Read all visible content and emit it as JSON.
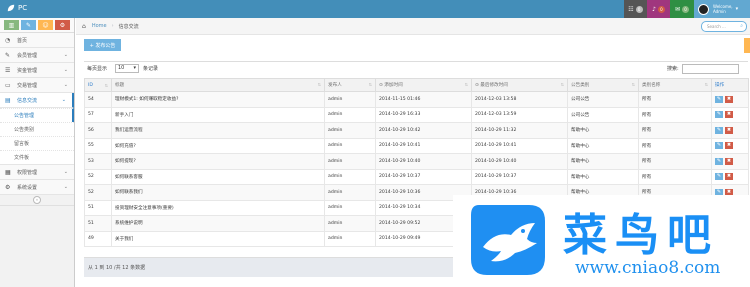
{
  "navbar": {
    "brand": "PC",
    "colors": {
      "bar": "#438eb9",
      "tasks": "#555555",
      "notifications": "#a0367e",
      "messages": "#2f8f43",
      "user": "#62a8d1"
    },
    "buttons": [
      {
        "icon": "tasks-icon",
        "badge": "0"
      },
      {
        "icon": "bell-icon",
        "badge": "0"
      },
      {
        "icon": "envelope-icon",
        "badge": "0"
      }
    ],
    "user": {
      "greeting": "Welcome,",
      "name": "Admin",
      "caret": "▾"
    }
  },
  "sidebar": {
    "shortcut_colors": [
      "#87b87f",
      "#6fb3e0",
      "#ffb752",
      "#d15b47"
    ],
    "shortcut_icons": [
      "chart-icon",
      "pencil-icon",
      "users-icon",
      "cogs-icon"
    ],
    "items": [
      {
        "label": "首页",
        "icon": "dashboard-icon"
      },
      {
        "label": "会员管理",
        "icon": "edit-icon"
      },
      {
        "label": "资金管理",
        "icon": "list-icon"
      },
      {
        "label": "交易管理",
        "icon": "desktop-icon"
      },
      {
        "label": "信息交流",
        "icon": "list-alt-icon",
        "active": true
      },
      {
        "label": "权限管理",
        "icon": "calendar-icon"
      },
      {
        "label": "系统设置",
        "icon": "gear-icon"
      }
    ],
    "submenu": [
      "公告管理",
      "公告类别",
      "留言板",
      "文件板"
    ],
    "collapse_glyph": "«"
  },
  "breadcrumbs": {
    "home": "Home",
    "current": "信息交流"
  },
  "search": {
    "placeholder": "Search ..."
  },
  "content": {
    "add_button": "+ 发布公告",
    "length_label": "每页显示",
    "length_value": "10",
    "length_suffix": "条记录",
    "filter_label": "搜索:"
  },
  "table": {
    "columns": [
      "ID",
      "标题",
      "发布人",
      "⊙ 添加时间",
      "⊙ 最后修改时间",
      "公告类别",
      "类别名称",
      "操作"
    ],
    "rows": [
      {
        "id": "54",
        "title": "理财模式1: 如何赚取稳定收益?",
        "author": "admin",
        "added": "2014-11-15 01:46",
        "modified": "2014-12-03 13:58",
        "category": "公司公告",
        "catname": "所有"
      },
      {
        "id": "57",
        "title": "新手入门",
        "author": "admin",
        "added": "2014-10-29 16:33",
        "modified": "2014-12-03 13:59",
        "category": "公司公告",
        "catname": "所有"
      },
      {
        "id": "56",
        "title": "我们运营流程",
        "author": "admin",
        "added": "2014-10-29 10:42",
        "modified": "2014-10-29 11:32",
        "category": "帮助中心",
        "catname": "所有"
      },
      {
        "id": "55",
        "title": "如何充值?",
        "author": "admin",
        "added": "2014-10-29 10:41",
        "modified": "2014-10-29 10:41",
        "category": "帮助中心",
        "catname": "所有"
      },
      {
        "id": "53",
        "title": "如何提现?",
        "author": "admin",
        "added": "2014-10-29 10:40",
        "modified": "2014-10-29 10:40",
        "category": "帮助中心",
        "catname": "所有"
      },
      {
        "id": "52",
        "title": "如何联系客服",
        "author": "admin",
        "added": "2014-10-29 10:37",
        "modified": "2014-10-29 10:37",
        "category": "帮助中心",
        "catname": "所有"
      },
      {
        "id": "52",
        "title": "如何联系我们",
        "author": "admin",
        "added": "2014-10-29 10:36",
        "modified": "2014-10-29 10:36",
        "category": "帮助中心",
        "catname": "所有"
      },
      {
        "id": "51",
        "title": "投资理财安全注意事项(重要)",
        "author": "admin",
        "added": "2014-10-29 10:34",
        "modified": "",
        "category": "",
        "catname": ""
      },
      {
        "id": "51",
        "title": "系统维护说明",
        "author": "admin",
        "added": "2014-10-29 09:52",
        "modified": "",
        "category": "",
        "catname": ""
      },
      {
        "id": "49",
        "title": "关于我们",
        "author": "admin",
        "added": "2014-10-29 09:49",
        "modified": "",
        "category": "",
        "catname": ""
      }
    ]
  },
  "pager": {
    "info": "从 1 到 10 /共 12 条数据"
  },
  "watermark": {
    "text": "菜鸟吧",
    "url": "www.cniao8.com"
  }
}
